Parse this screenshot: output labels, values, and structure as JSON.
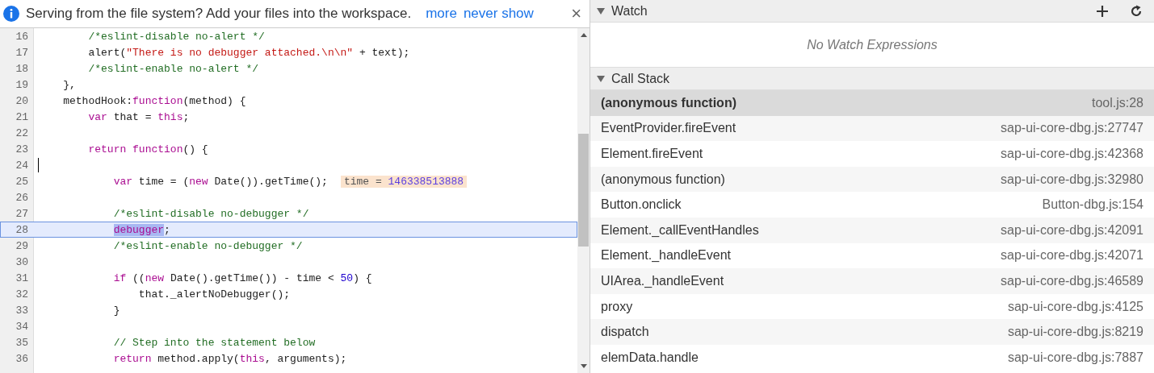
{
  "infobar": {
    "message": "Serving from the file system? Add your files into the workspace.",
    "links": [
      "more",
      "never show"
    ],
    "close": "×"
  },
  "editor": {
    "lines": [
      {
        "n": "16",
        "current": false,
        "cursor": false,
        "tokens": [
          {
            "t": "        /*eslint-disable no-alert */",
            "kind": "comment"
          }
        ]
      },
      {
        "n": "17",
        "current": false,
        "cursor": false,
        "tokens": [
          {
            "t": "        alert(",
            "kind": "plain"
          },
          {
            "t": "\"There is no debugger attached.\\n\\n\"",
            "kind": "string"
          },
          {
            "t": " + text);",
            "kind": "plain"
          }
        ]
      },
      {
        "n": "18",
        "current": false,
        "cursor": false,
        "tokens": [
          {
            "t": "        /*eslint-enable no-alert */",
            "kind": "comment"
          }
        ]
      },
      {
        "n": "19",
        "current": false,
        "cursor": false,
        "tokens": [
          {
            "t": "    },",
            "kind": "plain"
          }
        ]
      },
      {
        "n": "20",
        "current": false,
        "cursor": false,
        "tokens": [
          {
            "t": "    methodHook:",
            "kind": "plain"
          },
          {
            "t": "function",
            "kind": "keyword"
          },
          {
            "t": "(method) {",
            "kind": "plain"
          }
        ]
      },
      {
        "n": "21",
        "current": false,
        "cursor": false,
        "tokens": [
          {
            "t": "        var",
            "kind": "keyword"
          },
          {
            "t": " that = ",
            "kind": "plain"
          },
          {
            "t": "this",
            "kind": "keyword"
          },
          {
            "t": ";",
            "kind": "plain"
          }
        ]
      },
      {
        "n": "22",
        "current": false,
        "cursor": false
      },
      {
        "n": "23",
        "current": false,
        "cursor": false,
        "tokens": [
          {
            "t": "        return",
            "kind": "keyword"
          },
          {
            "t": " function",
            "kind": "keyword"
          },
          {
            "t": "() {",
            "kind": "plain"
          }
        ]
      },
      {
        "n": "24",
        "current": false,
        "cursor": true
      },
      {
        "n": "25",
        "current": false,
        "cursor": false,
        "tokens": [
          {
            "t": "            var",
            "kind": "keyword"
          },
          {
            "t": " time = (",
            "kind": "plain"
          },
          {
            "t": "new",
            "kind": "keyword"
          },
          {
            "t": " Date()).getTime();",
            "kind": "plain"
          }
        ],
        "inline_value": {
          "name": "time =",
          "value": "146338513888"
        }
      },
      {
        "n": "26",
        "current": false,
        "cursor": false
      },
      {
        "n": "27",
        "current": false,
        "cursor": false,
        "tokens": [
          {
            "t": "            /*eslint-disable no-debugger */",
            "kind": "comment"
          }
        ]
      },
      {
        "n": "28",
        "current": true,
        "cursor": false,
        "tokens": [
          {
            "t": "            debugger",
            "kind": "selection"
          },
          {
            "t": ";",
            "kind": "plain"
          }
        ]
      },
      {
        "n": "29",
        "current": false,
        "cursor": false,
        "tokens": [
          {
            "t": "            /*eslint-enable no-debugger */",
            "kind": "comment"
          }
        ]
      },
      {
        "n": "30",
        "current": false,
        "cursor": false
      },
      {
        "n": "31",
        "current": false,
        "cursor": false,
        "tokens": [
          {
            "t": "            if",
            "kind": "keyword"
          },
          {
            "t": " ((",
            "kind": "plain"
          },
          {
            "t": "new",
            "kind": "keyword"
          },
          {
            "t": " Date().getTime()) - time < ",
            "kind": "plain"
          },
          {
            "t": "50",
            "kind": "number"
          },
          {
            "t": ") {",
            "kind": "plain"
          }
        ]
      },
      {
        "n": "32",
        "current": false,
        "cursor": false,
        "tokens": [
          {
            "t": "                that._alertNoDebugger();",
            "kind": "plain"
          }
        ]
      },
      {
        "n": "33",
        "current": false,
        "cursor": false,
        "tokens": [
          {
            "t": "            }",
            "kind": "plain"
          }
        ]
      },
      {
        "n": "34",
        "current": false,
        "cursor": false
      },
      {
        "n": "35",
        "current": false,
        "cursor": false,
        "tokens": [
          {
            "t": "            // Step into the statement below",
            "kind": "comment"
          }
        ]
      },
      {
        "n": "36",
        "current": false,
        "cursor": false,
        "tokens": [
          {
            "t": "            return",
            "kind": "keyword"
          },
          {
            "t": " method.apply(",
            "kind": "plain"
          },
          {
            "t": "this",
            "kind": "keyword"
          },
          {
            "t": ", arguments);",
            "kind": "plain"
          }
        ]
      }
    ]
  },
  "watch": {
    "title": "Watch",
    "expanded": true,
    "empty": "No Watch Expressions"
  },
  "call_stack": {
    "title": "Call Stack",
    "expanded": true,
    "frames": [
      {
        "name": "(anonymous function)",
        "location": "tool.js:28",
        "selected": true
      },
      {
        "name": "EventProvider.fireEvent",
        "location": "sap-ui-core-dbg.js:27747",
        "selected": false
      },
      {
        "name": "Element.fireEvent",
        "location": "sap-ui-core-dbg.js:42368",
        "selected": false
      },
      {
        "name": "(anonymous function)",
        "location": "sap-ui-core-dbg.js:32980",
        "selected": false
      },
      {
        "name": "Button.onclick",
        "location": "Button-dbg.js:154",
        "selected": false
      },
      {
        "name": "Element._callEventHandles",
        "location": "sap-ui-core-dbg.js:42091",
        "selected": false
      },
      {
        "name": "Element._handleEvent",
        "location": "sap-ui-core-dbg.js:42071",
        "selected": false
      },
      {
        "name": "UIArea._handleEvent",
        "location": "sap-ui-core-dbg.js:46589",
        "selected": false
      },
      {
        "name": "proxy",
        "location": "sap-ui-core-dbg.js:4125",
        "selected": false
      },
      {
        "name": "dispatch",
        "location": "sap-ui-core-dbg.js:8219",
        "selected": false
      },
      {
        "name": "elemData.handle",
        "location": "sap-ui-core-dbg.js:7887",
        "selected": false
      }
    ]
  }
}
